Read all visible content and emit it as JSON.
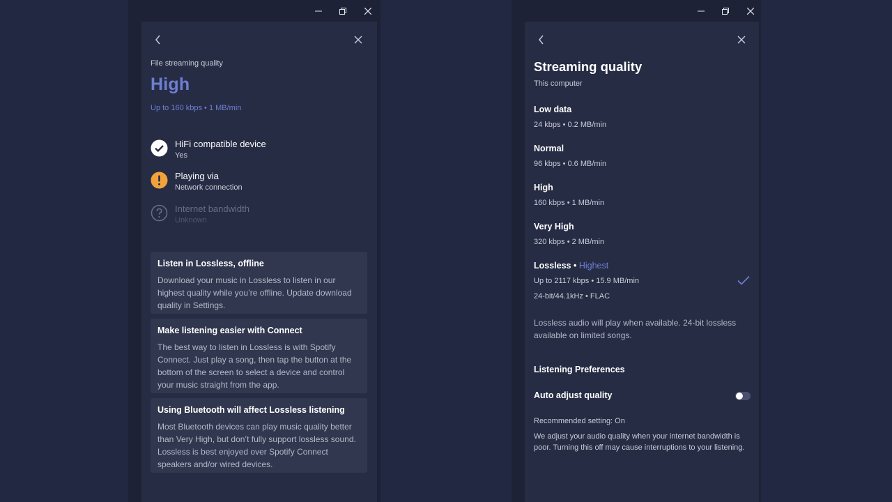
{
  "left": {
    "label": "File streaming quality",
    "quality": "High",
    "quality_detail": "Up to 160 kbps • 1 MB/min",
    "statuses": [
      {
        "title": "HiFi compatible device",
        "value": "Yes",
        "icon": "check-circle-icon"
      },
      {
        "title": "Playing via",
        "value": "Network connection",
        "icon": "warning-icon"
      },
      {
        "title": "Internet bandwidth",
        "value": "Unknown",
        "icon": "question-icon"
      }
    ],
    "cards": [
      {
        "title": "Listen in Lossless, offline",
        "body": "Download your music in Lossless to listen in our highest quality while you’re offline. Update download quality in Settings."
      },
      {
        "title": "Make listening easier with Connect",
        "body": "The best way to listen in Lossless is with Spotify Connect. Just play a song, then tap the button at the bottom of the screen to select a device and control your music straight from the app."
      },
      {
        "title": "Using Bluetooth will affect Lossless listening",
        "body": "Most Bluetooth devices can play music quality better than Very High, but don’t fully support lossless sound. Lossless is best enjoyed over Spotify Connect speakers and/or wired devices."
      }
    ]
  },
  "right": {
    "title": "Streaming quality",
    "subtitle": "This computer",
    "options": [
      {
        "name": "Low data",
        "detail": "24 kbps • 0.2 MB/min"
      },
      {
        "name": "Normal",
        "detail": "96 kbps • 0.6 MB/min"
      },
      {
        "name": "High",
        "detail": "160 kbps • 1 MB/min"
      },
      {
        "name": "Very High",
        "detail": "320 kbps • 2 MB/min"
      }
    ],
    "lossless": {
      "name": "Lossless",
      "separator": " • ",
      "tag": "Highest",
      "detail": "Up to 2117 kbps • 15.9 MB/min",
      "format": "24-bit/44.1kHz • FLAC",
      "selected": true
    },
    "lossless_note": "Lossless audio will play when available. 24-bit lossless available on limited songs.",
    "pref_heading": "Listening Preferences",
    "auto_adjust_label": "Auto adjust quality",
    "auto_adjust_on": false,
    "recommended": "Recommended setting: On",
    "auto_adjust_desc": "We adjust your audio quality when your internet bandwidth is poor. Turning this off may cause interruptions to your listening."
  }
}
